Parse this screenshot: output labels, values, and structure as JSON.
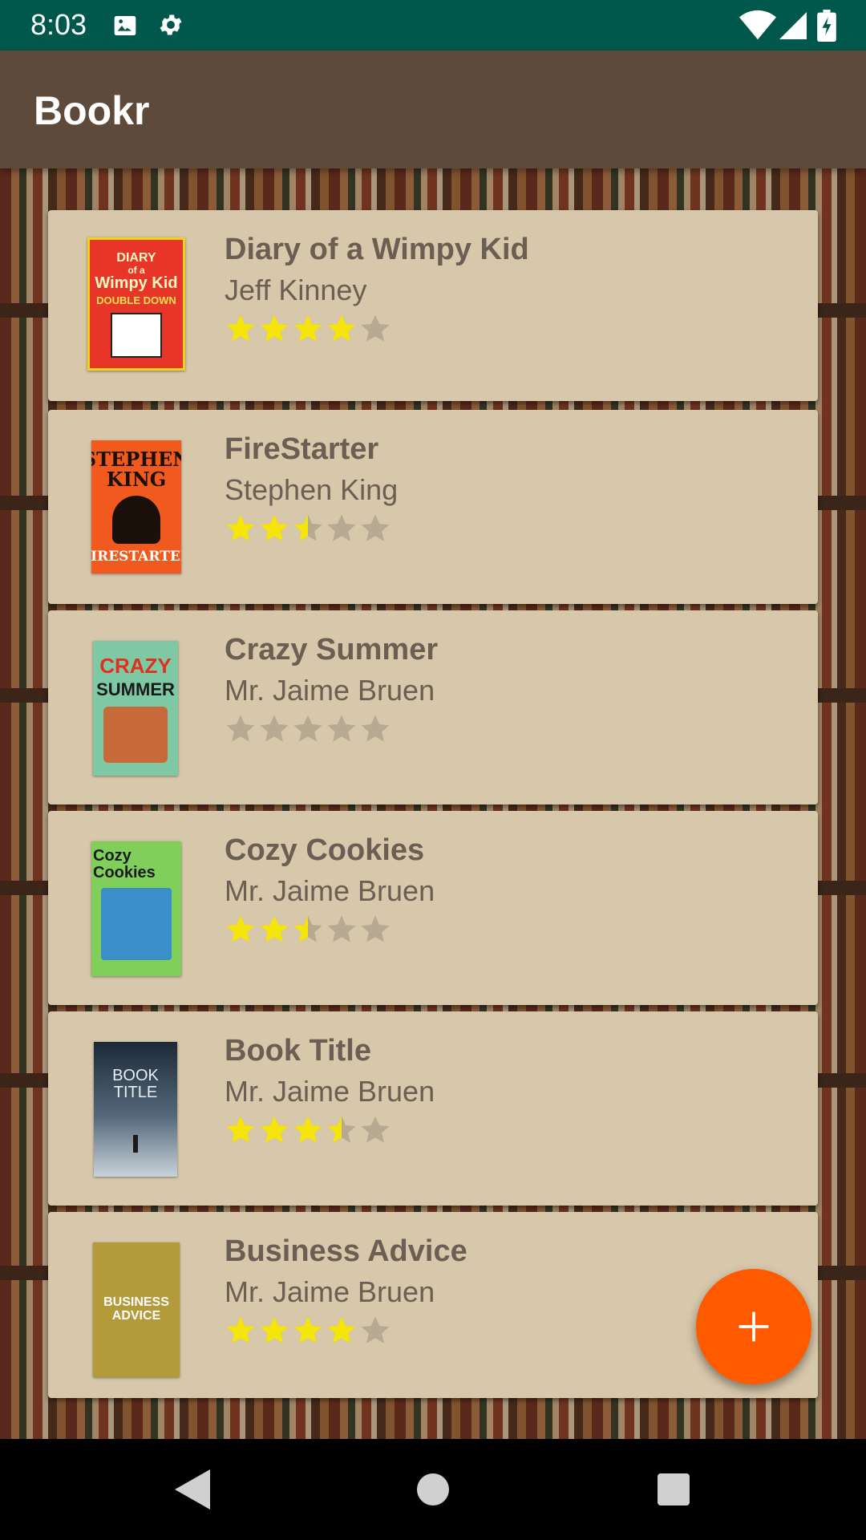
{
  "status_bar": {
    "time": "8:03",
    "icons": [
      "image-icon",
      "gear-icon",
      "wifi-icon",
      "signal-icon",
      "battery-icon"
    ]
  },
  "app_bar": {
    "title": "Bookr",
    "background": "#5d4a3b"
  },
  "colors": {
    "status_bar": "#00574b",
    "card": "#d7c7ab",
    "text": "#6b5e52",
    "star_filled": "#f5e50a",
    "star_empty": "#b7aa93",
    "fab": "#ff5a00"
  },
  "books": [
    {
      "title": "Diary of a Wimpy Kid",
      "author": "Jeff Kinney",
      "rating": 4,
      "cover": {
        "lines": [
          "DIARY",
          "of a",
          "Wimpy Kid",
          "DOUBLE DOWN"
        ],
        "bg": "#e8352a",
        "fg": "#fff6c0"
      }
    },
    {
      "title": "FireStarter",
      "author": "Stephen King",
      "rating": 2.5,
      "cover": {
        "lines": [
          "STEPHEN",
          "KING",
          "",
          "FIRESTARTER"
        ],
        "bg": "#f05a1e",
        "fg": "#1b0f0a"
      }
    },
    {
      "title": "Crazy Summer",
      "author": "Mr. Jaime Bruen",
      "rating": 0,
      "cover": {
        "lines": [
          "CRAZY",
          "SUMMER"
        ],
        "bg": "#7ec9a3",
        "fg": "#1a1a1a"
      }
    },
    {
      "title": "Cozy Cookies",
      "author": "Mr. Jaime Bruen",
      "rating": 2.5,
      "cover": {
        "lines": [
          "Cozy",
          "Cookies"
        ],
        "bg": "#7fcf5a",
        "fg": "#1a1a1a"
      }
    },
    {
      "title": "Book Title",
      "author": "Mr. Jaime Bruen",
      "rating": 3.5,
      "cover": {
        "lines": [
          "BOOK",
          "TITLE"
        ],
        "bg": "#2a3a4a",
        "fg": "#e8eef2"
      }
    },
    {
      "title": "Business Advice",
      "author": "Mr. Jaime Bruen",
      "rating": 4,
      "cover": {
        "lines": [
          "BUSINESS",
          "ADVICE"
        ],
        "bg": "#b39a3a",
        "fg": "#ffffff"
      }
    }
  ],
  "fab": {
    "icon": "plus-icon"
  },
  "nav_bar": {
    "icons": [
      "back-icon",
      "home-icon",
      "recents-icon"
    ]
  }
}
